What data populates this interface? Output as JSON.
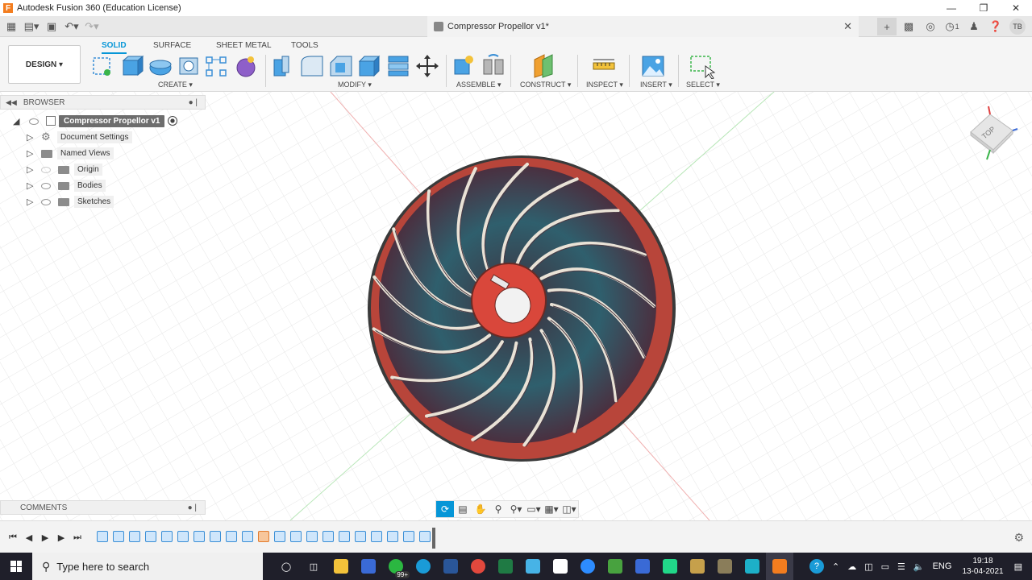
{
  "window": {
    "title": "Autodesk Fusion 360 (Education License)"
  },
  "document": {
    "title": "Compressor Propellor v1*"
  },
  "account": {
    "initials": "TB",
    "jobs_count": "1"
  },
  "workspace": {
    "label": "DESIGN"
  },
  "tabs": [
    "SOLID",
    "SURFACE",
    "SHEET METAL",
    "TOOLS"
  ],
  "groups": {
    "create": "CREATE",
    "modify": "MODIFY",
    "assemble": "ASSEMBLE",
    "construct": "CONSTRUCT",
    "inspect": "INSPECT",
    "insert": "INSERT",
    "select": "SELECT"
  },
  "browser": {
    "title": "BROWSER",
    "root": "Compressor Propellor v1",
    "items": [
      "Document Settings",
      "Named Views",
      "Origin",
      "Bodies",
      "Sketches"
    ]
  },
  "comments": {
    "title": "COMMENTS"
  },
  "viewcube": {
    "face": "TOP"
  },
  "taskbar": {
    "search_placeholder": "Type here to search",
    "badge": "99+",
    "lang": "ENG",
    "time": "19:18",
    "date": "13-04-2021"
  },
  "colors": {
    "accent": "#0696d7",
    "hub": "#d9473b",
    "blade": "#2f5f6d"
  }
}
